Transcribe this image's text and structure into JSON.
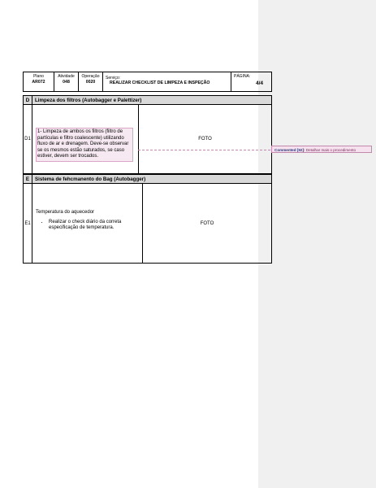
{
  "header": {
    "plano_label": "Plano",
    "plano_value": "AR072",
    "atividade_label": "Atividade",
    "atividade_value": "048",
    "operacao_label": "Operação",
    "operacao_value": "0020",
    "servico_label": "Serviço:",
    "servico_value": "REALIZAR CHECKLIST DE LIMPEZA E INSPEÇÃO",
    "pagina_label": "PÁGINA:",
    "pagina_value": "4/4"
  },
  "section_d": {
    "letter": "D",
    "title": "Limpeza dos filtros (Autobagger e Palettizer)",
    "row_id": "D1",
    "text": "1- Limpeza de ambos os filtros (filtro de partículas e filtro coalescente) utilizando fluxo de ar e drenagem. Deve-se observar se os mesmos estão saturados, se caso estiver, devem ser trocados.",
    "photo": "FOTO"
  },
  "section_e": {
    "letter": "E",
    "title": "Sistema de fehcmanento do Bag (Autobagger)",
    "row_id": "E1",
    "intro": "Temperatura do aquecedor",
    "bullets": [
      "Realizar o check diário da correta especificação de temperatura."
    ],
    "photo": "FOTO"
  },
  "comment": {
    "author": "Commented [92]:",
    "text": "Detalhar mais o procedimento"
  },
  "colors": {
    "section_header_bg": "#d9d9d9",
    "comment_bg": "#f6e2ee",
    "comment_border": "#c289ad",
    "sidebar_bg": "#f0f0f0"
  }
}
